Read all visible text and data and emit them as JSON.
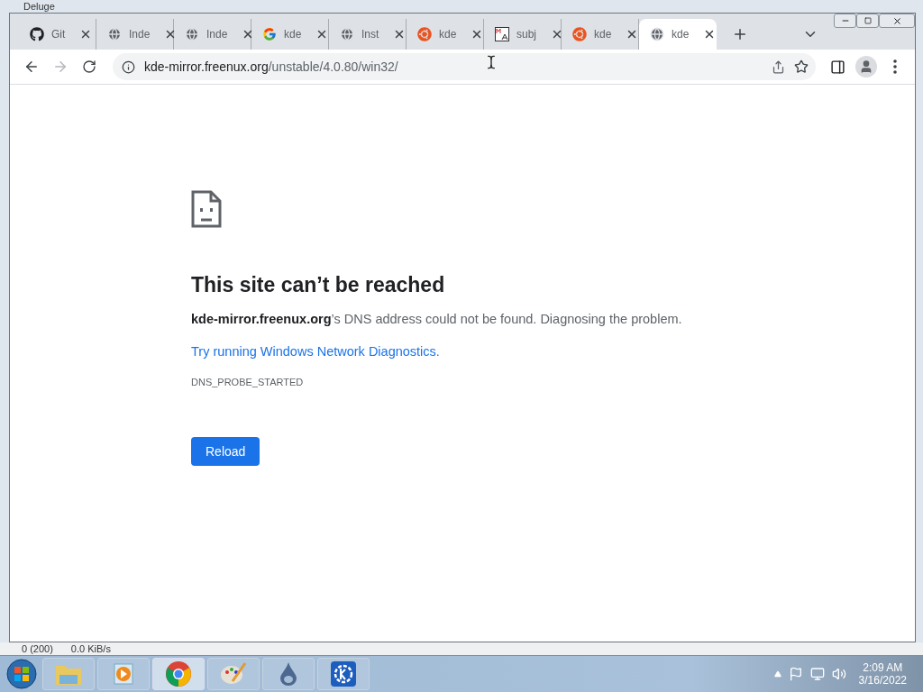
{
  "background_window": {
    "title": "Deluge",
    "status": [
      "0 (200)",
      "0.0 KiB/s"
    ]
  },
  "tabs": [
    {
      "title": "Git",
      "kind": "github",
      "selected": false
    },
    {
      "title": "Inde",
      "kind": "globe",
      "selected": false
    },
    {
      "title": "Inde",
      "kind": "globe",
      "selected": false
    },
    {
      "title": "kde",
      "kind": "google",
      "selected": false
    },
    {
      "title": "Inst",
      "kind": "globe",
      "selected": false
    },
    {
      "title": "kde",
      "kind": "ubuntu",
      "selected": false
    },
    {
      "title": "subj",
      "kind": "ma",
      "selected": false
    },
    {
      "title": "kde",
      "kind": "ubuntu",
      "selected": false
    },
    {
      "title": "kde",
      "kind": "globe",
      "selected": true
    }
  ],
  "address_bar": {
    "host": "kde-mirror.freenux.org",
    "path": "/unstable/4.0.80/win32/"
  },
  "error_page": {
    "heading": "This site can’t be reached",
    "message": "**kde-mirror.freenux.org**’s DNS address could not be found. Diagnosing the problem.",
    "link": "Try running Windows Network Diagnostics.",
    "code": "DNS_PROBE_STARTED",
    "button": "Reload"
  },
  "taskbar": {
    "apps": [
      {
        "kind": "explorer",
        "selected": false
      },
      {
        "kind": "media",
        "selected": false
      },
      {
        "kind": "chrome",
        "selected": true
      },
      {
        "kind": "paint",
        "selected": false
      },
      {
        "kind": "drop",
        "selected": false
      },
      {
        "kind": "kde",
        "selected": false
      }
    ],
    "time": "2:09 AM",
    "date": "3/16/2022"
  }
}
